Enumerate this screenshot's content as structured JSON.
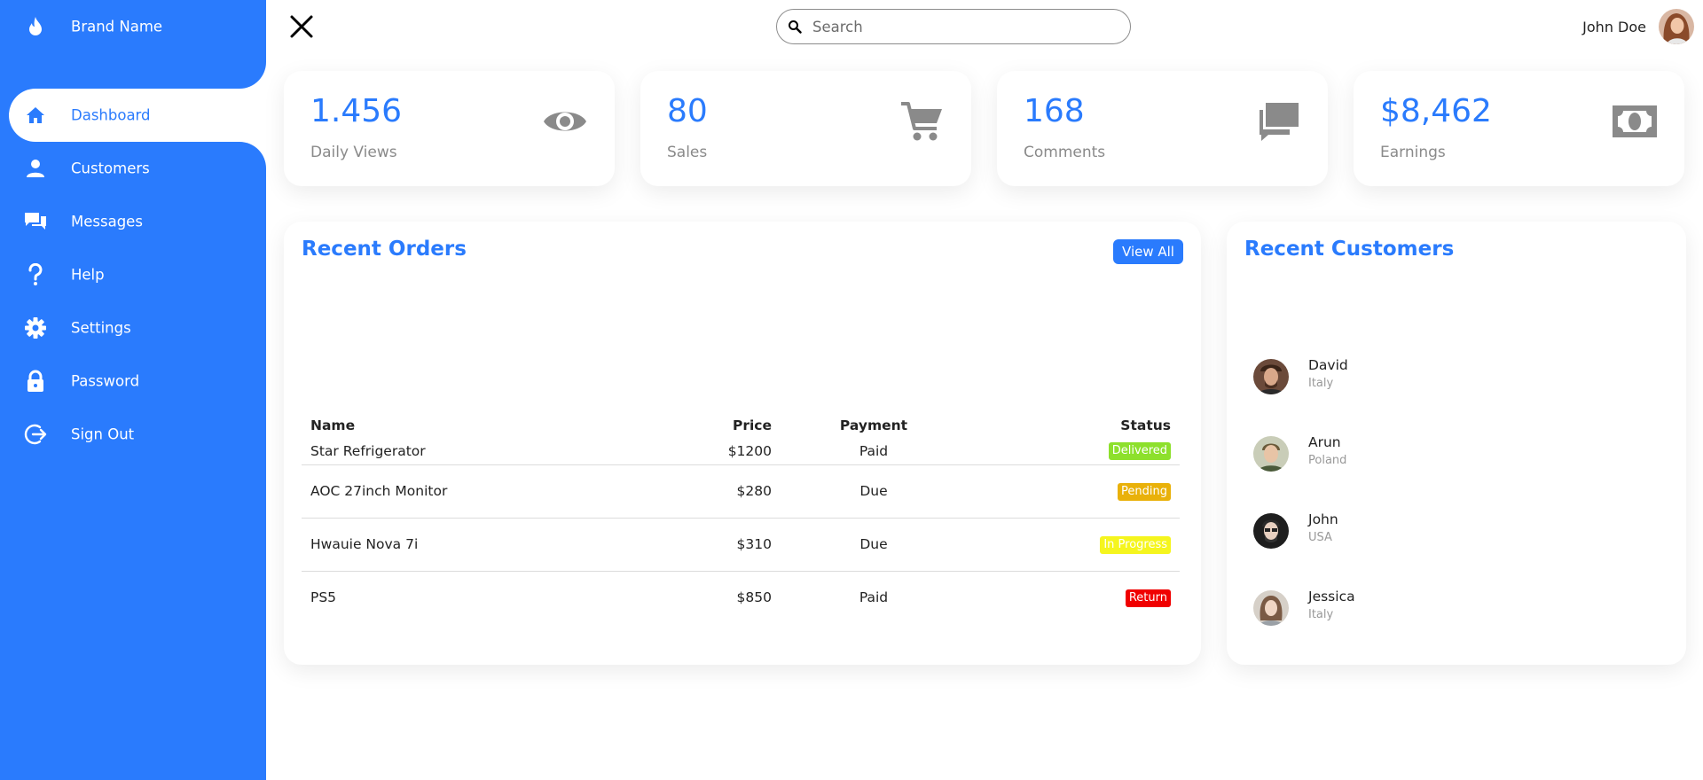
{
  "brand": {
    "name": "Brand Name",
    "icon": "flame-icon"
  },
  "sidebar": {
    "items": [
      {
        "label": "Dashboard",
        "icon": "home-icon",
        "active": true
      },
      {
        "label": "Customers",
        "icon": "person-icon"
      },
      {
        "label": "Messages",
        "icon": "chat-icon"
      },
      {
        "label": "Help",
        "icon": "question-icon"
      },
      {
        "label": "Settings",
        "icon": "gear-icon"
      },
      {
        "label": "Password",
        "icon": "lock-icon"
      },
      {
        "label": "Sign Out",
        "icon": "logout-icon"
      }
    ]
  },
  "topbar": {
    "search": {
      "placeholder": "Search",
      "value": ""
    },
    "user": {
      "name": "John Doe"
    }
  },
  "cards": [
    {
      "value": "1.456",
      "label": "Daily Views",
      "icon": "eye-icon"
    },
    {
      "value": "80",
      "label": "Sales",
      "icon": "cart-icon"
    },
    {
      "value": "168",
      "label": "Comments",
      "icon": "comments-icon"
    },
    {
      "value": "$8,462",
      "label": "Earnings",
      "icon": "cash-icon"
    }
  ],
  "orders": {
    "title": "Recent Orders",
    "view_all": "View All",
    "columns": [
      "Name",
      "Price",
      "Payment",
      "Status"
    ],
    "rows": [
      {
        "name": "Star Refrigerator",
        "price": "$1200",
        "payment": "Paid",
        "status": "Delivered",
        "status_color": "#8de02c"
      },
      {
        "name": "AOC 27inch Monitor",
        "price": "$280",
        "payment": "Due",
        "status": "Pending",
        "status_color": "#e9b10a"
      },
      {
        "name": "Hwauie Nova 7i",
        "price": "$310",
        "payment": "Due",
        "status": "In Progress",
        "status_color": "#f5f51e"
      },
      {
        "name": "PS5",
        "price": "$850",
        "payment": "Paid",
        "status": "Return",
        "status_color": "#f00000"
      }
    ]
  },
  "customers": {
    "title": "Recent Customers",
    "items": [
      {
        "name": "David",
        "country": "Italy"
      },
      {
        "name": "Arun",
        "country": "Poland"
      },
      {
        "name": "John",
        "country": "USA"
      },
      {
        "name": "Jessica",
        "country": "Italy"
      }
    ]
  },
  "colors": {
    "accent": "#2a7bfd",
    "muted": "#8a8a8a"
  }
}
